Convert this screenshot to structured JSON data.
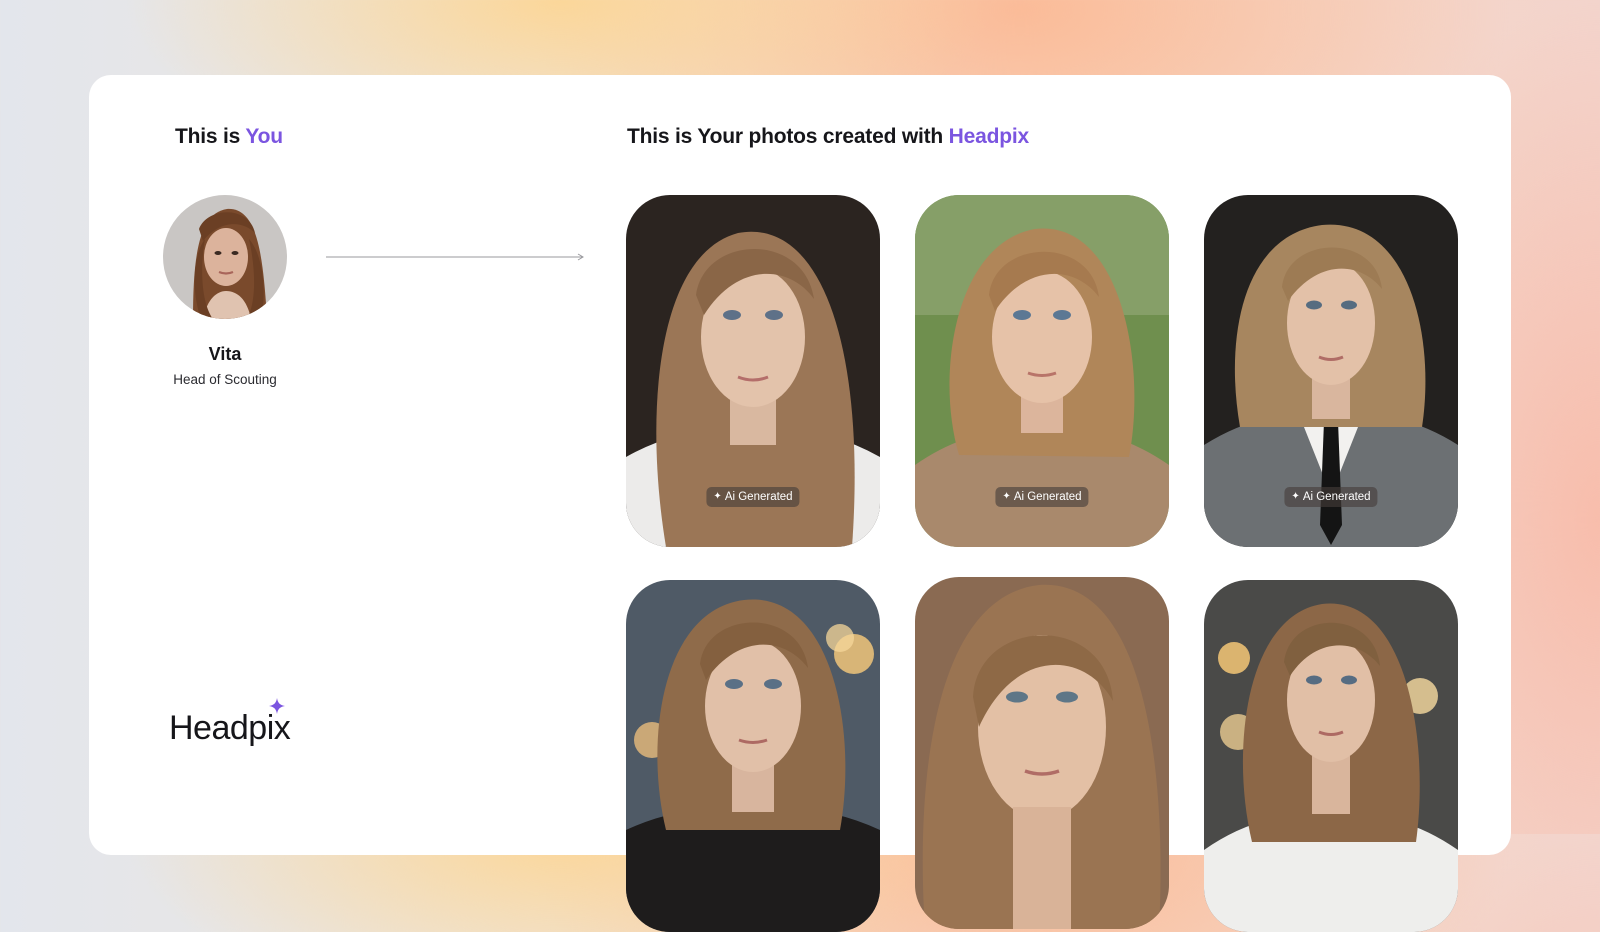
{
  "you_section": {
    "heading_prefix": "This is ",
    "heading_accent": "You",
    "name": "Vita",
    "role": "Head of Scouting"
  },
  "photos_section": {
    "heading_prefix": "This is Your photos created with ",
    "heading_accent": "Headpix",
    "badge_label": "Ai Generated",
    "photos": [
      {
        "name": "photo-white-blouse"
      },
      {
        "name": "photo-knit-sweater"
      },
      {
        "name": "photo-grey-suit-tie"
      },
      {
        "name": "photo-leather-jacket"
      },
      {
        "name": "photo-warm-closeup"
      },
      {
        "name": "photo-white-shirt-bokeh"
      }
    ]
  },
  "brand": {
    "logo_text": "Headpix",
    "accent_color": "#7b55e0"
  },
  "icons": {
    "arrow": "long-right-arrow-icon",
    "sparkle": "sparkle-icon"
  }
}
